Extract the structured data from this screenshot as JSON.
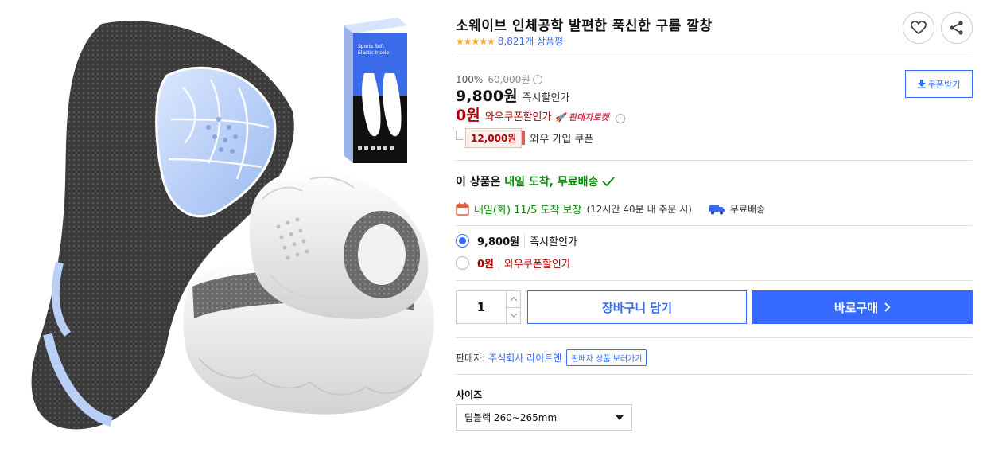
{
  "product": {
    "title": "소웨이브 인체공학 발편한 푹신한 구름 깔창",
    "rating_stars": "★★★★★",
    "review_count": "8,821개 상품평",
    "box_text_1": "Sports Soft",
    "box_text_2": "Elastic Insole"
  },
  "pricing": {
    "discount_rate": "100%",
    "original_price": "60,000원",
    "sale_price": "9,800원",
    "sale_label": "즉시할인가",
    "wow_price": "0원",
    "wow_label": "와우쿠폰할인가",
    "rocket_badge": "판매자로켓",
    "coupon_amount": "12,000원",
    "coupon_label": "와우 가입 쿠폰",
    "coupon_download": "쿠폰받기"
  },
  "delivery": {
    "headline_prefix": "이 상품은 ",
    "headline_highlight": "내일 도착, 무료배송",
    "arrival": "내일(화) 11/5 도착 보장",
    "arrival_note": "(12시간 40분 내 주문 시)",
    "free_shipping": "무료배송"
  },
  "options": [
    {
      "price": "9,800원",
      "label": "즉시할인가",
      "selected": true
    },
    {
      "price": "0원",
      "label": "와우쿠폰할인가",
      "selected": false
    }
  ],
  "purchase": {
    "quantity": "1",
    "cart_label": "장바구니 담기",
    "buy_label": "바로구매"
  },
  "seller": {
    "label": "판매자:",
    "name": "주식회사 라이트엔",
    "link": "판매자 상품 보러가기"
  },
  "size": {
    "label": "사이즈",
    "selected": "딥블랙 260~265mm"
  },
  "colors": {
    "accent": "#346aff",
    "wow_red": "#ae0000",
    "green": "#008c00",
    "star": "#f5a623"
  }
}
